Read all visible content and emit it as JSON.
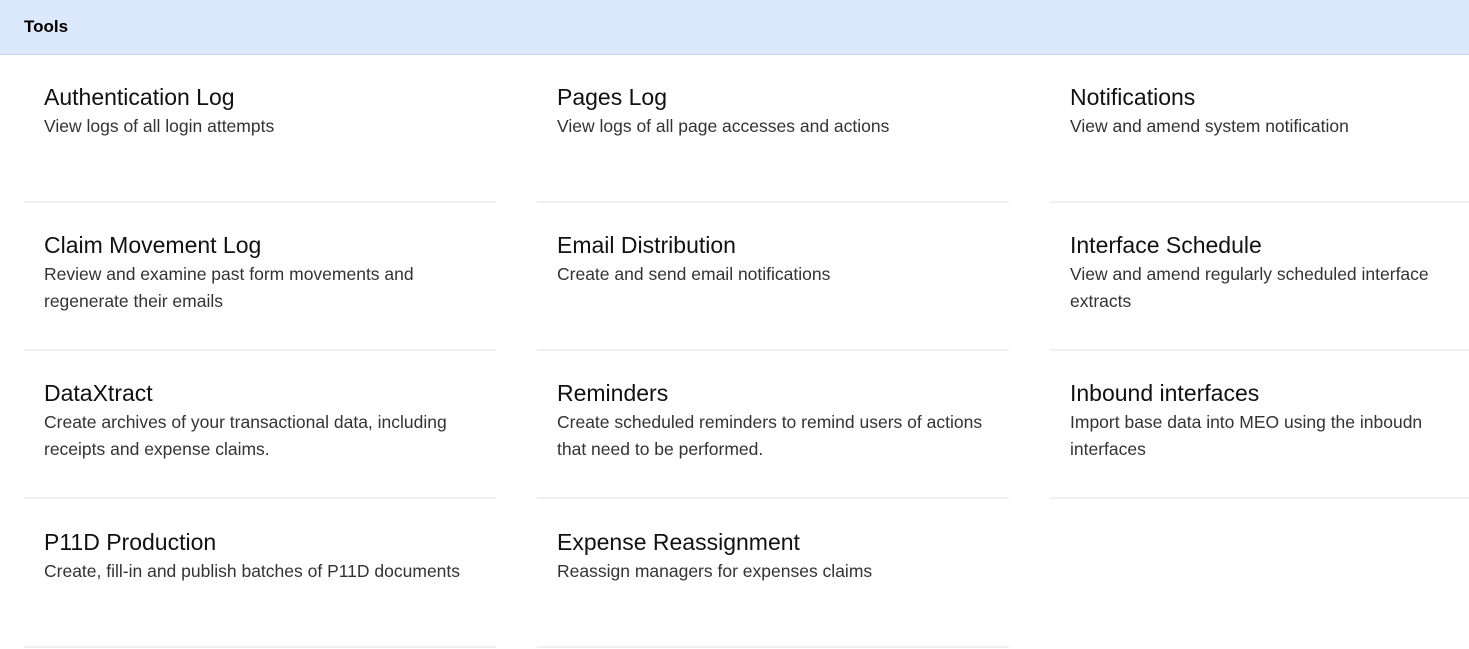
{
  "header": {
    "title": "Tools"
  },
  "tiles": [
    {
      "title": "Authentication Log",
      "description": "View logs of all login attempts"
    },
    {
      "title": "Pages Log",
      "description": "View logs of all page accesses and actions"
    },
    {
      "title": "Notifications",
      "description": "View and amend system notification"
    },
    {
      "title": "Claim Movement Log",
      "description": "Review and examine past form movements and regenerate their emails"
    },
    {
      "title": "Email Distribution",
      "description": "Create and send email notifications"
    },
    {
      "title": "Interface Schedule",
      "description": "View and amend regularly scheduled interface extracts"
    },
    {
      "title": "DataXtract",
      "description": "Create archives of your transactional data, including receipts and expense claims."
    },
    {
      "title": "Reminders",
      "description": "Create scheduled reminders to remind users of actions that need to be performed."
    },
    {
      "title": "Inbound interfaces",
      "description": "Import base data into MEO using the inboudn interfaces"
    },
    {
      "title": "P11D Production",
      "description": "Create, fill-in and publish batches of P11D documents"
    },
    {
      "title": "Expense Reassignment",
      "description": "Reassign managers for expenses claims"
    }
  ]
}
